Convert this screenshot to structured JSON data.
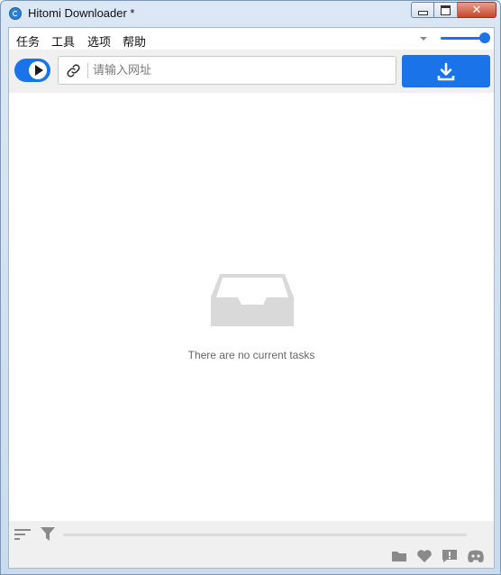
{
  "window": {
    "title": "Hitomi Downloader *",
    "icon": "hitomi-app-icon",
    "controls": {
      "minimize": "minimize-icon",
      "maximize": "maximize-icon",
      "close_label": "✕"
    }
  },
  "menu": {
    "items": [
      {
        "label": "任务"
      },
      {
        "label": "工具"
      },
      {
        "label": "选项"
      },
      {
        "label": "帮助"
      }
    ],
    "volume_level": 1.0
  },
  "toolbar": {
    "toggle_icon": "play-icon",
    "url_icon": "link-icon",
    "url_placeholder": "请输入网址",
    "url_value": "",
    "download_icon": "download-icon"
  },
  "content": {
    "empty_icon": "inbox-tray-icon",
    "empty_message": "There are no current tasks"
  },
  "bottombar": {
    "left_icons": [
      "sort-icon",
      "filter-icon"
    ],
    "progress": 0,
    "right_icons": [
      "folder-icon",
      "heart-icon",
      "feedback-icon",
      "discord-icon"
    ]
  },
  "colors": {
    "accent": "#1a73e8",
    "toolbar_bg": "#f0f0f0",
    "empty_icon": "#d9d9d9",
    "muted_icon": "#8a8a8a"
  }
}
